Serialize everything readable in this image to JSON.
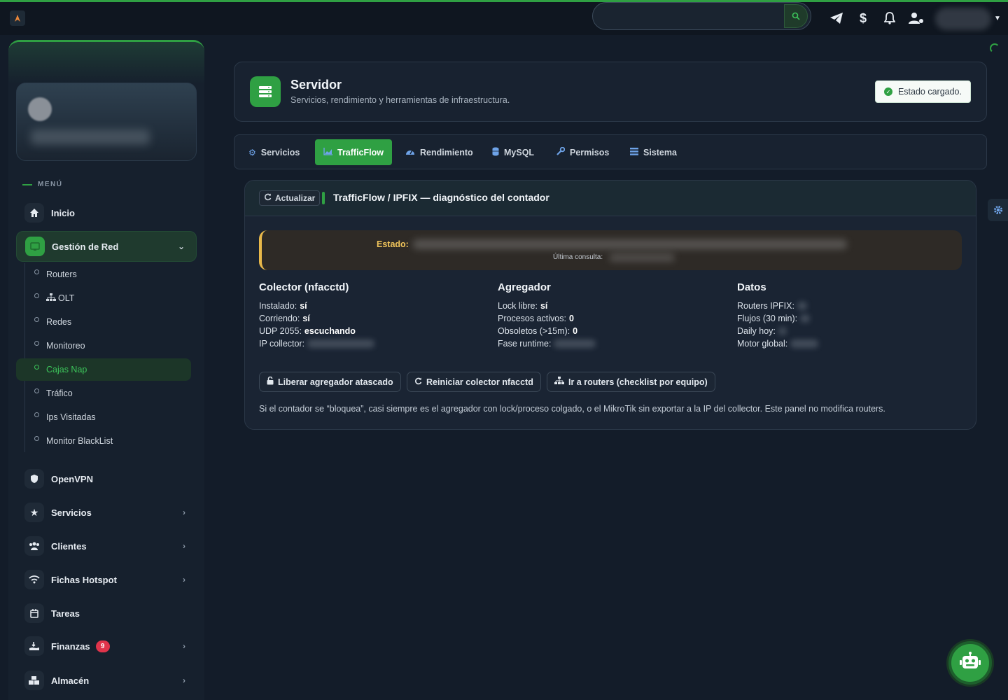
{
  "colors": {
    "accent": "#2fa043",
    "warning": "#f0c45b",
    "badge": "#e0344b",
    "icon_blue": "#6ea3e8"
  },
  "topbar": {
    "icons": [
      "telegram-icon",
      "dollar-icon",
      "bell-icon",
      "user-cog-icon"
    ]
  },
  "sidebar": {
    "menu_label": "MENÚ",
    "items": [
      {
        "label": "Inicio",
        "icon": "home-icon"
      },
      {
        "label": "Gestión de Red",
        "icon": "network-icon"
      },
      {
        "label": "OpenVPN",
        "icon": "shield-icon"
      },
      {
        "label": "Servicios",
        "icon": "star-icon"
      },
      {
        "label": "Clientes",
        "icon": "users-icon"
      },
      {
        "label": "Fichas Hotspot",
        "icon": "wifi-icon"
      },
      {
        "label": "Tareas",
        "icon": "calendar-icon"
      },
      {
        "label": "Finanzas",
        "icon": "hand-money-icon",
        "badge": "9"
      },
      {
        "label": "Almacén",
        "icon": "boxes-icon"
      }
    ],
    "subitems": [
      "Routers",
      "OLT",
      "Redes",
      "Monitoreo",
      "Cajas Nap",
      "Tráfico",
      "Ips Visitadas",
      "Monitor BlackList"
    ]
  },
  "header": {
    "title": "Servidor",
    "subtitle": "Servicios, rendimiento y herramientas de infraestructura.",
    "status": "Estado cargado."
  },
  "tabs": [
    "Servicios",
    "TrafficFlow",
    "Rendimiento",
    "MySQL",
    "Permisos",
    "Sistema"
  ],
  "trafficflow": {
    "refresh_label": "Actualizar",
    "title": "TrafficFlow / IPFIX — diagnóstico del contador",
    "estado_label": "Estado:",
    "ultima_label": "Última consulta:",
    "collector": {
      "title": "Colector (nfacctd)",
      "installed_k": "Instalado:",
      "installed_v": "sí",
      "running_k": "Corriendo:",
      "running_v": "sí",
      "udp_k": "UDP 2055:",
      "udp_v": "escuchando",
      "ip_k": "IP collector:"
    },
    "aggregator": {
      "title": "Agregador",
      "lock_k": "Lock libre:",
      "lock_v": "sí",
      "procs_k": "Procesos activos:",
      "procs_v": "0",
      "obs_k": "Obsoletos (>15m):",
      "obs_v": "0",
      "fase_k": "Fase runtime:"
    },
    "datos": {
      "title": "Datos",
      "routers_k": "Routers IPFIX:",
      "flujos_k": "Flujos (30 min):",
      "daily_k": "Daily hoy:",
      "motor_k": "Motor global:"
    },
    "actions": {
      "release": "Liberar agregador atascado",
      "restart": "Reiniciar colector nfacctd",
      "routers": "Ir a routers (checklist por equipo)"
    },
    "note": "Si el contador se “bloquea”, casi siempre es el agregador con lock/proceso colgado, o el MikroTik sin exportar a la IP del collector. Este panel no modifica routers."
  }
}
